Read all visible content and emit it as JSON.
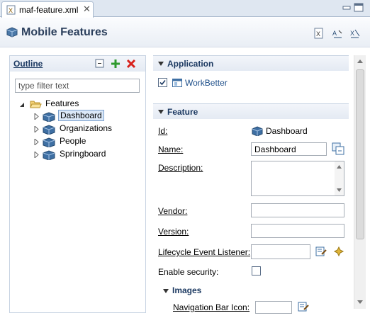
{
  "tab": {
    "title": "maf-feature.xml",
    "close_glyph": "✕"
  },
  "header": {
    "title": "Mobile Features",
    "icons": [
      "source-view-icon",
      "sort-icon",
      "validate-icon"
    ]
  },
  "outline": {
    "title": "Outline",
    "filter_placeholder": "type filter text",
    "root": "Features",
    "items": [
      "Dashboard",
      "Organizations",
      "People",
      "Springboard"
    ],
    "selected": "Dashboard"
  },
  "application": {
    "title": "Application",
    "checked": true,
    "name": "WorkBetter"
  },
  "feature": {
    "title": "Feature",
    "id_label": "Id:",
    "id_value": "Dashboard",
    "name_label": "Name:",
    "name_value": "Dashboard",
    "description_label": "Description:",
    "vendor_label": "Vendor:",
    "version_label": "Version:",
    "lifecycle_label": "Lifecycle Event Listener:",
    "security_label": "Enable security:",
    "images_title": "Images",
    "navbar_icon_label": "Navigation Bar Icon:"
  }
}
